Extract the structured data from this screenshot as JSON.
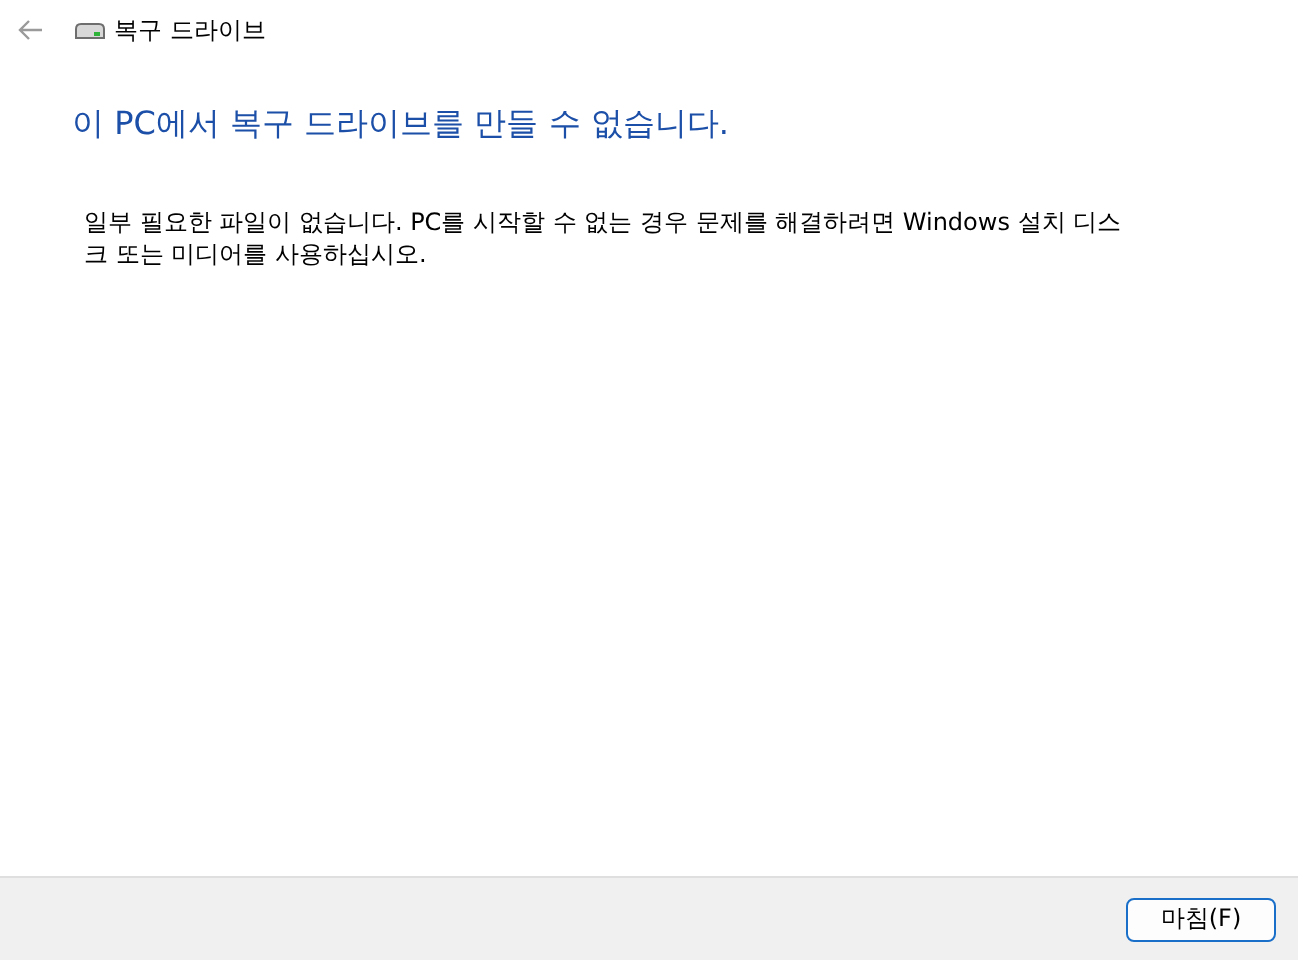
{
  "window": {
    "title": "복구 드라이브"
  },
  "heading": "이 PC에서 복구 드라이브를 만들 수 없습니다.",
  "message": "일부 필요한 파일이 없습니다. PC를 시작할 수 없는 경우 문제를 해결하려면 Windows 설치 디스크 또는 미디어를 사용하십시오.",
  "buttons": [
    {
      "label": "마침(F)",
      "kind": "default"
    }
  ]
}
